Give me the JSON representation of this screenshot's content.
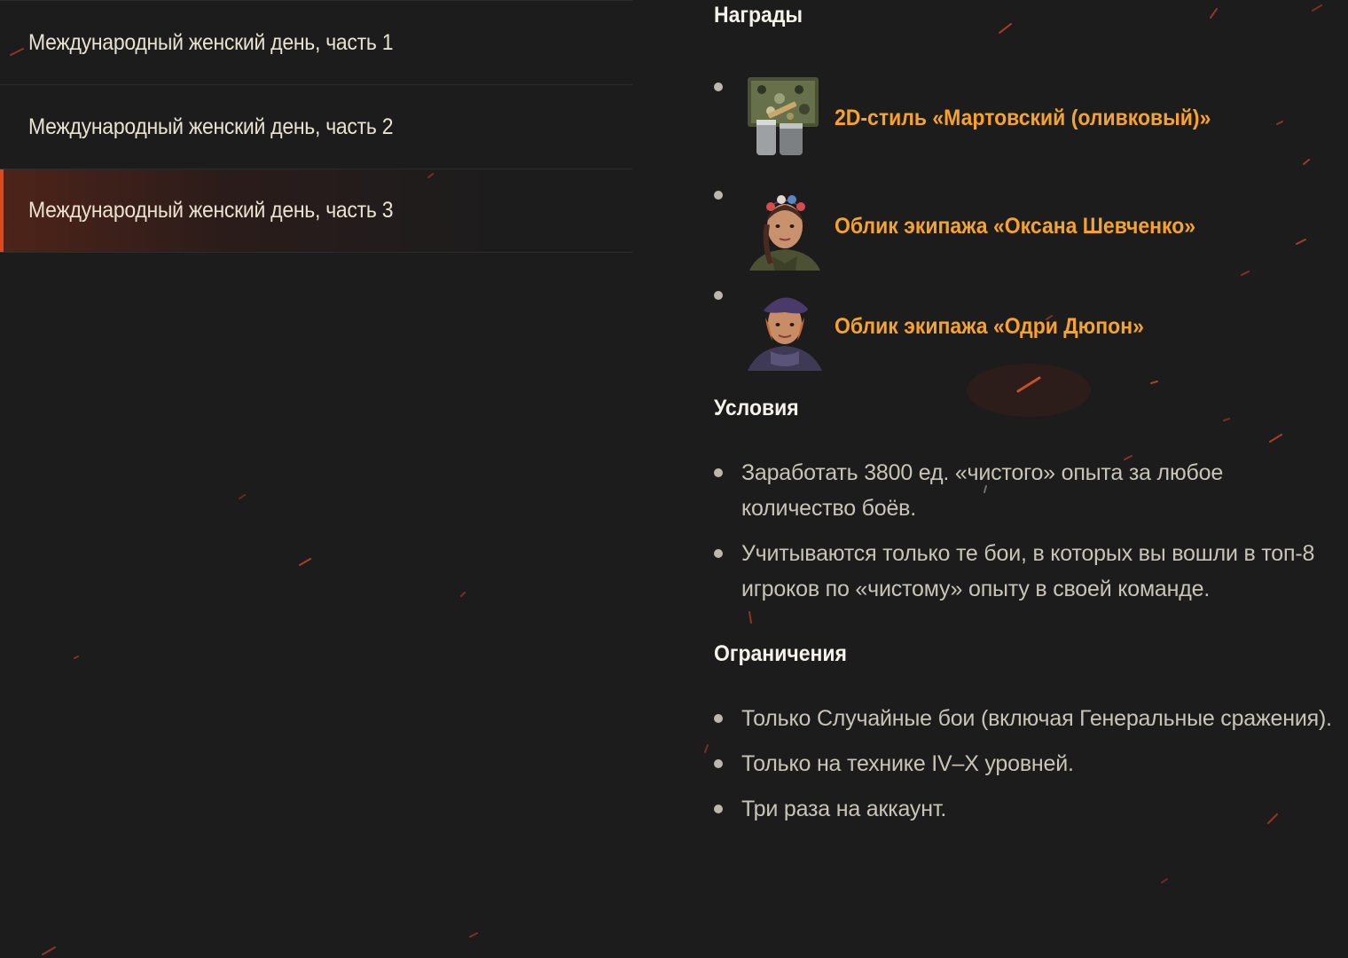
{
  "nav": {
    "items": [
      {
        "label": "Международный женский день, часть 1",
        "active": false
      },
      {
        "label": "Международный женский день, часть 2",
        "active": false
      },
      {
        "label": "Международный женский день, часть 3",
        "active": true
      }
    ]
  },
  "content": {
    "rewards_heading": "Награды",
    "rewards": [
      {
        "name": "2D-стиль «Мартовский (оливковый)»",
        "icon": "camouflage-style-icon"
      },
      {
        "name": "Облик экипажа «Оксана Шевченко»",
        "icon": "crew-portrait-oksana-icon"
      },
      {
        "name": "Облик экипажа «Одри Дюпон»",
        "icon": "crew-portrait-audrey-icon"
      }
    ],
    "conditions_heading": "Условия",
    "conditions": [
      "Заработать 3800 ед. «чистого» опыта за любое количество боёв.",
      "Учитываются только те бои, в которых вы вошли в топ-8 игроков по «чистому» опыту в своей команде."
    ],
    "restrictions_heading": "Ограничения",
    "restrictions": [
      "Только Случайные бои (включая Генеральные сражения).",
      "Только на технике IV–X уровней.",
      "Три раза на аккаунт."
    ]
  },
  "colors": {
    "background": "#1c1c1d",
    "accent": "#e0471e",
    "reward_text": "#f7a22b",
    "body_text": "#c9c4b6"
  }
}
